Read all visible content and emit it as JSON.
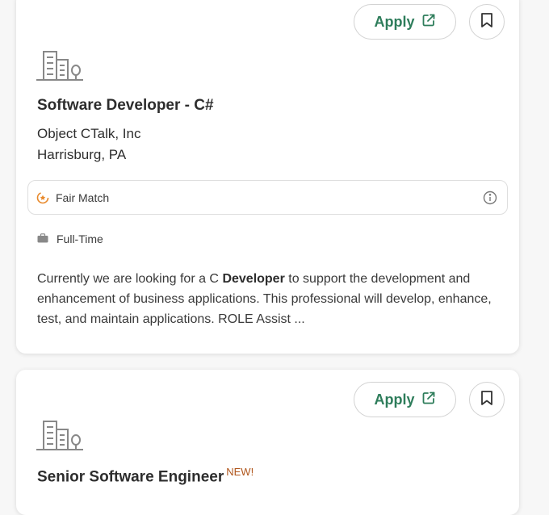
{
  "jobs": [
    {
      "apply_label": "Apply",
      "title": "Software Developer - C#",
      "badge": "",
      "company": "Object CTalk, Inc",
      "location": "Harrisburg, PA",
      "match": "Fair Match",
      "job_type": "Full-Time",
      "snippet_before": "Currently we are looking for a C ",
      "snippet_bold": "Developer",
      "snippet_after": " to support the development and enhancement of business applications. This professional will develop, enhance, test, and maintain applications. ROLE Assist ..."
    },
    {
      "apply_label": "Apply",
      "title": "Senior Software Engineer",
      "badge": "NEW!"
    }
  ],
  "icons": {
    "apply": "external-link-icon",
    "save": "bookmark-icon",
    "logo": "building-icon",
    "match": "match-star-icon",
    "info": "info-icon",
    "job_type": "briefcase-icon"
  },
  "colors": {
    "apply_text": "#2e7d5b",
    "new_badge": "#b0561c",
    "match_icon": "#e8892b"
  }
}
